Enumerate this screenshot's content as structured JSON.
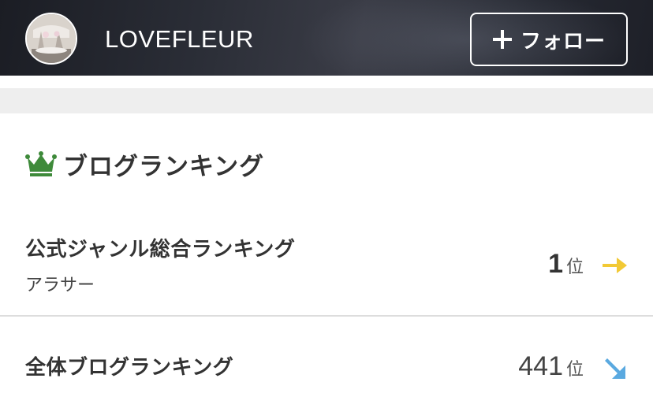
{
  "header": {
    "blog_name": "LOVEFLEUR",
    "follow_label": "フォロー",
    "avatar_icon": "profile-avatar",
    "plus_icon": "plus-icon"
  },
  "ranking": {
    "title": "ブログランキング",
    "crown_icon": "crown-icon",
    "crown_color": "#3e8a3a",
    "rows": [
      {
        "label": "公式ジャンル総合ランキング",
        "sub": "アラサー",
        "rank": "1",
        "unit": "位",
        "trend_icon": "arrow-right-icon",
        "trend_color": "#f2c935"
      },
      {
        "label": "全体ブログランキング",
        "sub": "",
        "rank": "441",
        "unit": "位",
        "trend_icon": "arrow-down-right-icon",
        "trend_color": "#5aa9e0"
      }
    ]
  }
}
